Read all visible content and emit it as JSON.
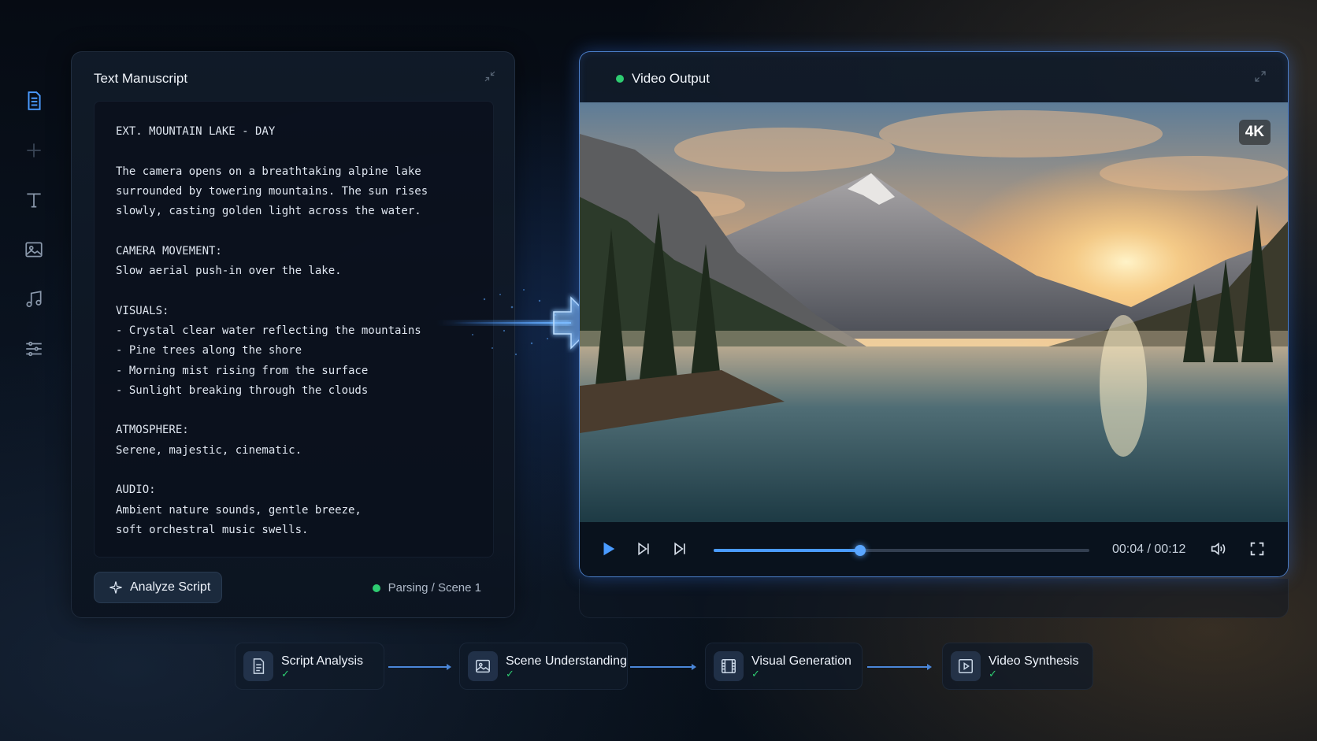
{
  "sidebar": {
    "items": [
      {
        "icon": "document-icon",
        "active": true
      },
      {
        "icon": "plus-icon",
        "active": false
      },
      {
        "icon": "text-icon",
        "active": false
      },
      {
        "icon": "image-icon",
        "active": false
      },
      {
        "icon": "music-icon",
        "active": false
      },
      {
        "icon": "sliders-icon",
        "active": false
      }
    ]
  },
  "manuscript": {
    "title": "Text Manuscript",
    "script_lines": [
      "EXT. MOUNTAIN LAKE - DAY",
      "",
      "The camera opens on a breathtaking alpine lake",
      "surrounded by towering mountains. The sun rises",
      "slowly, casting golden light across the water.",
      "",
      "CAMERA MOVEMENT:",
      "Slow aerial push-in over the lake.",
      "",
      "VISUALS:",
      "- Crystal clear water reflecting the mountains",
      "- Pine trees along the shore",
      "- Morning mist rising from the surface",
      "- Sunlight breaking through the clouds",
      "",
      "ATMOSPHERE:",
      "Serene, majestic, cinematic.",
      "",
      "AUDIO:",
      "Ambient nature sounds, gentle breeze,",
      "soft orchestral music swells."
    ],
    "analyze_button": "Analyze Script",
    "status": "Parsing / Scene 1"
  },
  "video": {
    "title": "Video Output",
    "resolution_badge": "4K",
    "timecode": "00:04 / 00:12",
    "progress": 0.39
  },
  "pipeline": {
    "steps": [
      {
        "label": "Script Analysis",
        "icon": "document-icon",
        "done": true
      },
      {
        "label": "Scene Understanding",
        "icon": "image-icon",
        "done": true
      },
      {
        "label": "Visual Generation",
        "icon": "film-icon",
        "done": true
      },
      {
        "label": "Video Synthesis",
        "icon": "play-icon",
        "done": true
      }
    ],
    "check_glyph": "✓"
  },
  "colors": {
    "accent": "#4a9bff",
    "status_green": "#2ecc71",
    "background": "#08101a"
  }
}
